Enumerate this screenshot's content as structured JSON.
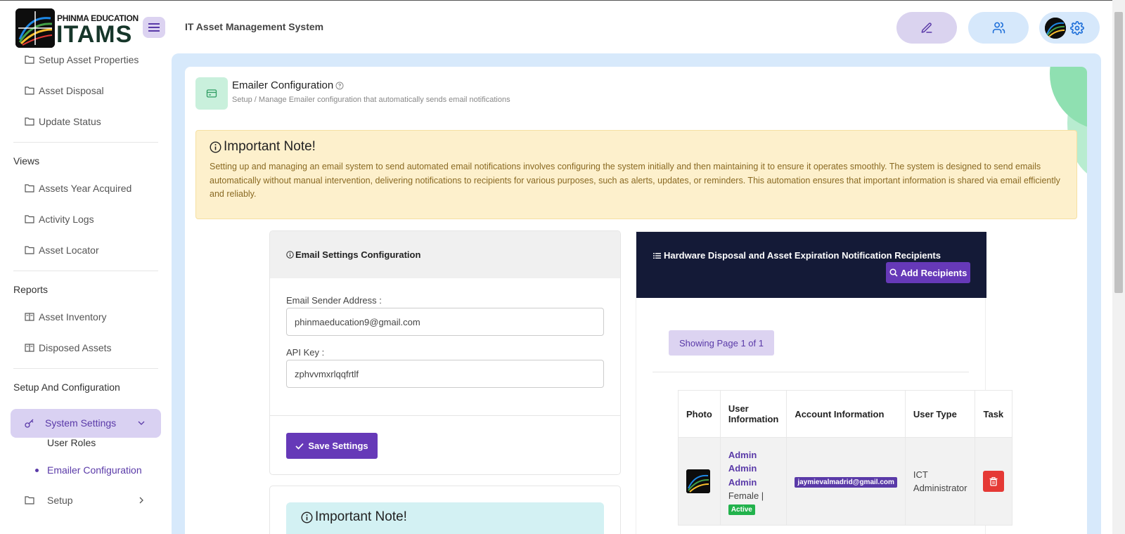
{
  "app": {
    "logo_top": "PHINMA EDUCATION",
    "logo_main": "ITAMS",
    "title": "IT Asset Management System"
  },
  "sidebar": {
    "items_top": [
      {
        "label": "Setup Asset Properties"
      },
      {
        "label": "Asset Disposal"
      },
      {
        "label": "Update Status"
      }
    ],
    "views_head": "Views",
    "views_items": [
      {
        "label": "Assets Year Acquired"
      },
      {
        "label": "Activity Logs"
      },
      {
        "label": "Asset Locator"
      }
    ],
    "reports_head": "Reports",
    "reports_items": [
      {
        "label": "Asset Inventory"
      },
      {
        "label": "Disposed Assets"
      }
    ],
    "setup_head": "Setup And Configuration",
    "active_item": "System Settings",
    "sub_items": [
      {
        "label": "User Roles"
      },
      {
        "label": "Emailer Configuration"
      }
    ],
    "setup_item": "Setup"
  },
  "page": {
    "title": "Emailer Configuration",
    "subtitle": "Setup / Manage Emailer configuration that automatically sends email notifications"
  },
  "note": {
    "title": "Important Note!",
    "text": "Setting up and managing an email system to send automated email notifications involves configuring the system initially and then maintaining it to ensure it operates smoothly. The system is designed to send emails automatically without manual intervention, delivering notifications to recipients for various purposes, such as alerts, updates, or reminders. This automation ensures that important information is shared via email efficiently and reliably."
  },
  "email_settings": {
    "title": "Email Settings Configuration",
    "sender_label": "Email Sender Address :",
    "sender_value": "phinmaeducation9@gmail.com",
    "api_label": "API Key :",
    "api_value": "zphvvmxrlqqfrtlf",
    "save_label": "Save Settings"
  },
  "note2": {
    "title": "Important Note!"
  },
  "recipients": {
    "title": "Hardware Disposal and Asset Expiration Notification Recipients",
    "add_label": "Add Recipients",
    "page_info": "Showing Page 1 of 1",
    "columns": [
      "Photo",
      "User Information",
      "Account Information",
      "User Type",
      "Task"
    ],
    "rows": [
      {
        "name_line1": "Admin",
        "name_line2": "Admin",
        "name_line3": "Admin",
        "gender": "Female |",
        "status": "Active",
        "email": "jaymievalmadrid@gmail.com",
        "user_type": "ICT Administrator"
      }
    ]
  },
  "colors": {
    "accent": "#6639b8",
    "dark_header": "#141a37",
    "note_bg": "#fdf0cc",
    "active_green": "#22b24c",
    "delete_red": "#e53935"
  }
}
